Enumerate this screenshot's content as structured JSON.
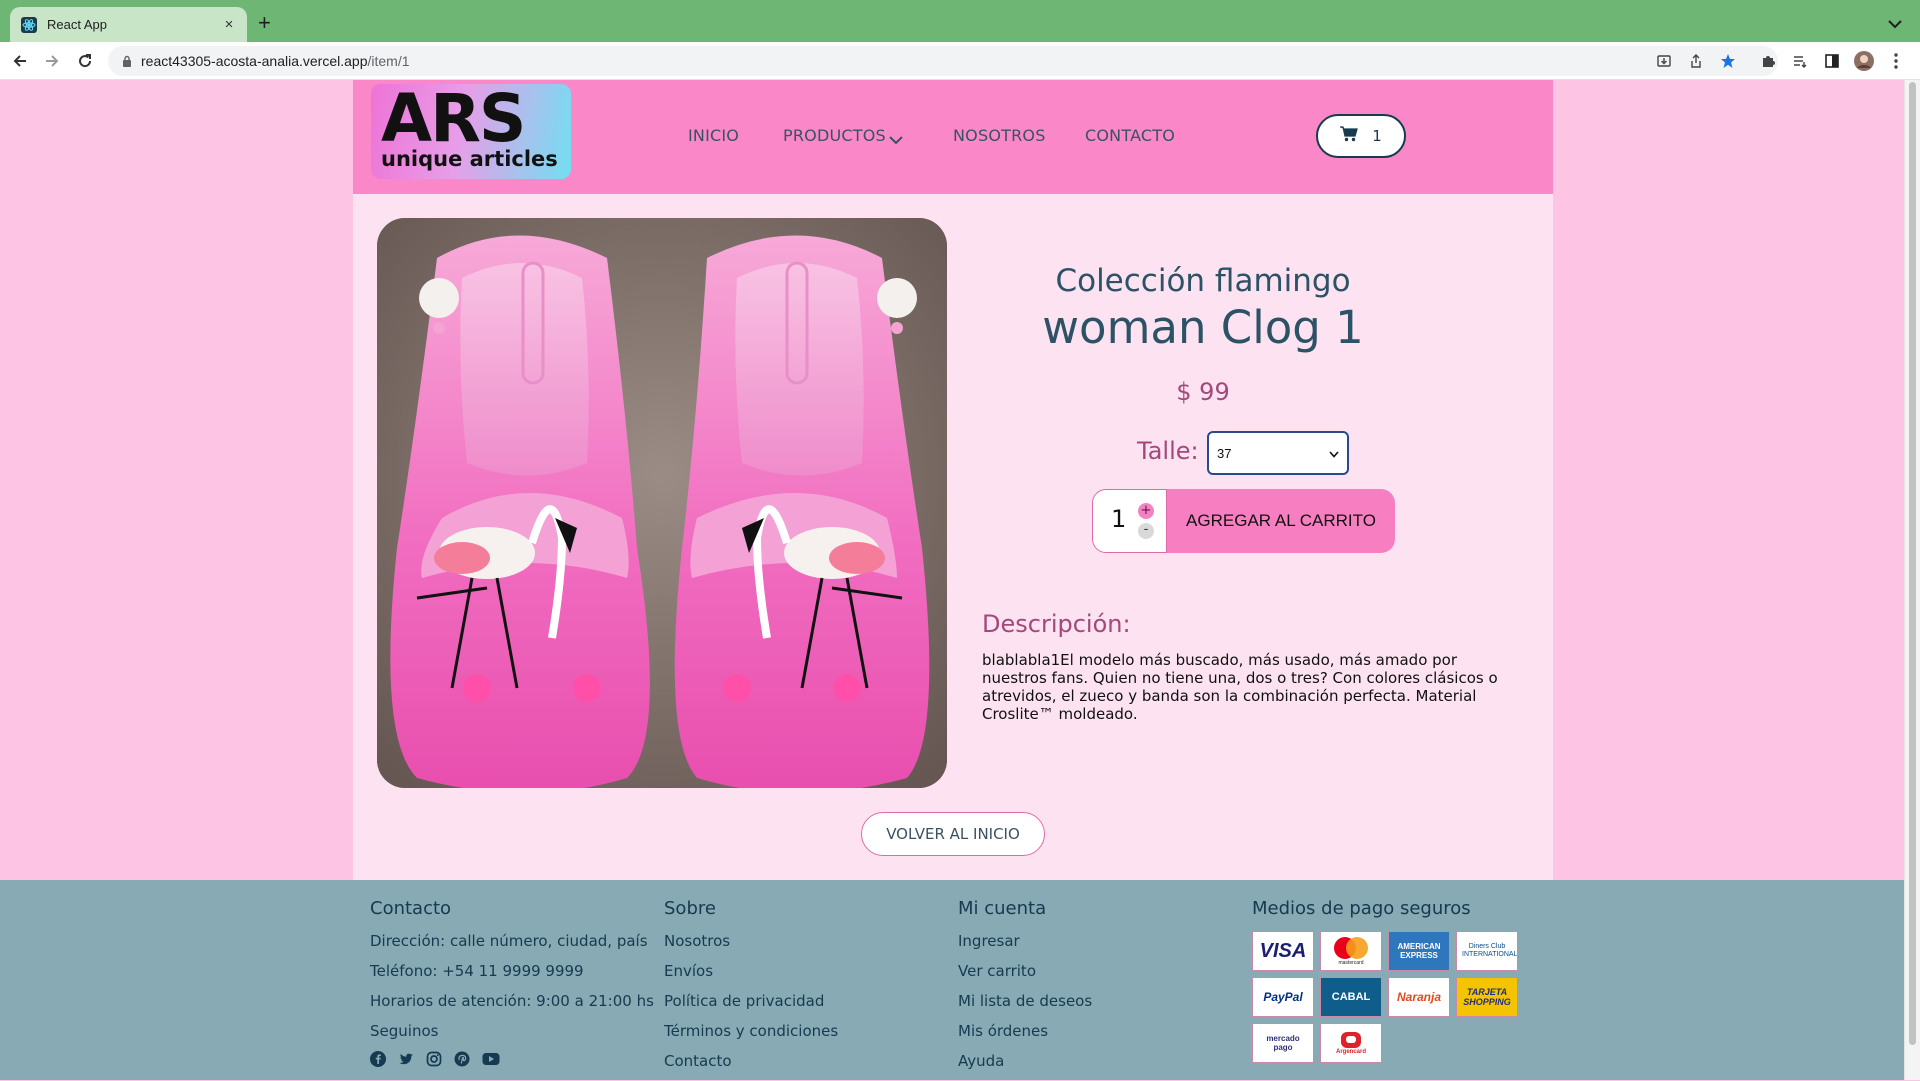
{
  "browser": {
    "tab_title": "React App",
    "tab_close": "×",
    "new_tab": "+",
    "url_host": "react43305-acosta-analia.vercel.app",
    "url_path": "/item/1"
  },
  "navbar": {
    "logo_big": "ARS",
    "logo_small": "unique articles",
    "links": [
      "INICIO",
      "PRODUCTOS",
      "NOSOTROS",
      "CONTACTO"
    ],
    "cart_count": "1"
  },
  "product": {
    "collection": "Colección flamingo",
    "name": "woman Clog 1",
    "price": "$ 99",
    "size_label": "Talle:",
    "size_selected": "37",
    "quantity": "1",
    "qty_plus": "+",
    "qty_minus": "-",
    "add_to_cart": "AGREGAR AL CARRITO",
    "description_title": "Descripción:",
    "description": "blablabla1El modelo más buscado, más usado, más amado por nuestros fans. Quien no tiene una, dos o tres? Con colores clásicos o atrevidos, el zueco y banda son la combinación perfecta. Material Croslite™ moldeado.",
    "back_button": "VOLVER AL INICIO"
  },
  "footer": {
    "contact": {
      "title": "Contacto",
      "items": [
        "Dirección: calle número, ciudad, país",
        "Teléfono: +54 11 9999 9999",
        "Horarios de atención: 9:00 a 21:00 hs",
        "Seguinos"
      ]
    },
    "about": {
      "title": "Sobre",
      "items": [
        "Nosotros",
        "Envíos",
        "Política de privacidad",
        "Términos y condiciones",
        "Contacto"
      ]
    },
    "account": {
      "title": "Mi cuenta",
      "items": [
        "Ingresar",
        "Ver carrito",
        "Mi lista de deseos",
        "Mis órdenes",
        "Ayuda"
      ]
    },
    "payments": {
      "title": "Medios de pago seguros",
      "methods": [
        {
          "label": "VISA",
          "icon": "visa-logo"
        },
        {
          "label": "mastercard",
          "icon": "mastercard-logo"
        },
        {
          "label": "AMERICAN EXPRESS",
          "icon": "amex-logo"
        },
        {
          "label": "Diners Club INTERNATIONAL",
          "icon": "diners-logo"
        },
        {
          "label": "PayPal",
          "icon": "paypal-logo"
        },
        {
          "label": "CABAL",
          "icon": "cabal-logo"
        },
        {
          "label": "Naranja",
          "icon": "naranja-logo"
        },
        {
          "label": "TARJETA SHOPPING",
          "icon": "shopping-logo"
        },
        {
          "label": "mercado pago",
          "icon": "mercadopago-logo"
        },
        {
          "label": "Argencard",
          "icon": "argencard-logo"
        }
      ]
    },
    "social_icons": [
      "facebook-icon",
      "twitter-icon",
      "instagram-icon",
      "pinterest-icon",
      "youtube-icon"
    ]
  },
  "colors": {
    "page_bg": "#fdc4e3",
    "navbar_bg": "#fa87c8",
    "content_bg": "#fde3f1",
    "accent_pink": "#f77fc1",
    "heading_teal": "#2c5265",
    "price_mauve": "#a2487a",
    "footer_bg": "#87aab4"
  }
}
